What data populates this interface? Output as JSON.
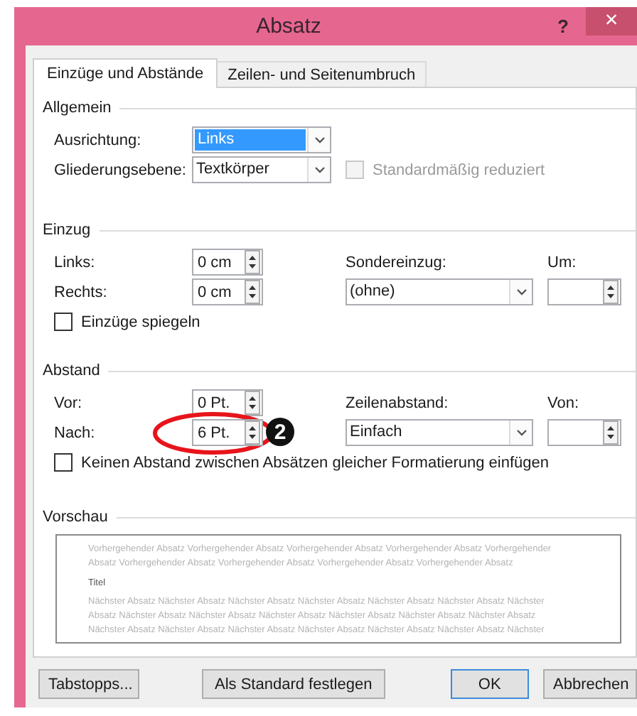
{
  "window": {
    "title": "Absatz",
    "help": "?",
    "close": "×"
  },
  "tabs": [
    {
      "label": "Einzüge und Abstände",
      "selected": true
    },
    {
      "label": "Zeilen- und Seitenumbruch",
      "selected": false
    }
  ],
  "general": {
    "heading": "Allgemein",
    "alignment": {
      "label": "Ausrichtung:",
      "value": "Links",
      "focused": true
    },
    "outline_level": {
      "label": "Gliederungsebene:",
      "value": "Textkörper",
      "focused": false
    },
    "collapsed": {
      "label": "Standardmäßig reduziert",
      "checked": false,
      "disabled": true
    }
  },
  "indent": {
    "heading": "Einzug",
    "left": {
      "label": "Links:",
      "value": "0 cm"
    },
    "right": {
      "label": "Rechts:",
      "value": "0 cm"
    },
    "special": {
      "label": "Sondereinzug:",
      "value": "(ohne)",
      "focused": false
    },
    "by": {
      "label": "Um:"
    },
    "mirror": {
      "label": "Einzüge spiegeln",
      "checked": false,
      "disabled": false
    }
  },
  "spacing": {
    "heading": "Abstand",
    "before": {
      "label": "Vor:",
      "value": "0 Pt."
    },
    "after": {
      "label": "Nach:",
      "value": "6 Pt.",
      "annotation": "2"
    },
    "line_spacing": {
      "label": "Zeilenabstand:",
      "value": "Einfach",
      "focused": false
    },
    "at": {
      "label": "Von:"
    },
    "no_space": {
      "label": "Keinen Abstand zwischen Absätzen gleicher Formatierung einfügen",
      "checked": false,
      "disabled": false
    }
  },
  "preview": {
    "heading": "Vorschau",
    "previous_lines": [
      "Vorhergehender Absatz Vorhergehender Absatz Vorhergehender Absatz Vorhergehender Absatz Vorhergehender",
      "Absatz Vorhergehender Absatz Vorhergehender Absatz Vorhergehender Absatz Vorhergehender Absatz"
    ],
    "title": "Titel",
    "next_lines": [
      "Nächster Absatz Nächster Absatz Nächster Absatz Nächster Absatz Nächster Absatz Nächster Absatz Nächster",
      "Absatz Nächster Absatz Nächster Absatz Nächster Absatz Nächster Absatz Nächster Absatz Nächster Absatz",
      "Nächster Absatz Nächster Absatz Nächster Absatz Nächster Absatz Nächster Absatz Nächster Absatz Nächster"
    ]
  },
  "buttons": [
    {
      "label": "Tabstopps...",
      "default": false
    },
    {
      "label": "Als Standard festlegen",
      "default": false
    },
    {
      "label": "OK",
      "default": true
    },
    {
      "label": "Abbrechen",
      "default": false
    }
  ]
}
